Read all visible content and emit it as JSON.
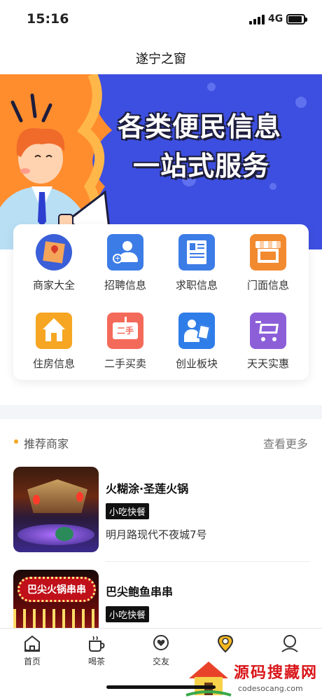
{
  "status_bar": {
    "time": "15:16",
    "network": "4G"
  },
  "nav": {
    "title": "遂宁之窗"
  },
  "banner": {
    "line1": "各类便民信息",
    "line2": "一站式服务"
  },
  "services": [
    {
      "label": "商家大全",
      "icon": "map-icon",
      "color": "#3a5fd8"
    },
    {
      "label": "招聘信息",
      "icon": "people-icon",
      "color": "#3c7ce6"
    },
    {
      "label": "求职信息",
      "icon": "resume-icon",
      "color": "#3c7ce6"
    },
    {
      "label": "门面信息",
      "icon": "storefront-icon",
      "color": "#f28a30"
    },
    {
      "label": "住房信息",
      "icon": "house-icon",
      "color": "#f6a623"
    },
    {
      "label": "二手买卖",
      "icon": "secondhand-sign-icon",
      "color": "#f46a5a"
    },
    {
      "label": "创业板块",
      "icon": "entrepreneur-icon",
      "color": "#2f7de8"
    },
    {
      "label": "天天实惠",
      "icon": "shopping-cart-icon",
      "color": "#8c5fd9"
    }
  ],
  "recommend": {
    "title": "推荐商家",
    "more": "查看更多"
  },
  "merchants": [
    {
      "name": "火糊涂·圣莲火锅",
      "tag": "小吃快餐",
      "address": "明月路现代不夜城7号"
    },
    {
      "name": "巴尖鲍鱼串串",
      "tag": "小吃快餐",
      "address": "",
      "sign_text": "巴尖火锅串串"
    }
  ],
  "tabs": [
    {
      "label": "首页",
      "icon": "home-icon"
    },
    {
      "label": "喝茶",
      "icon": "tea-cup-icon"
    },
    {
      "label": "交友",
      "icon": "heart-chat-icon"
    },
    {
      "label": "",
      "icon": "location-pin-icon"
    },
    {
      "label": "",
      "icon": "profile-icon"
    }
  ],
  "watermark": {
    "text": "源码搜藏网",
    "url": "codesocang.com"
  }
}
